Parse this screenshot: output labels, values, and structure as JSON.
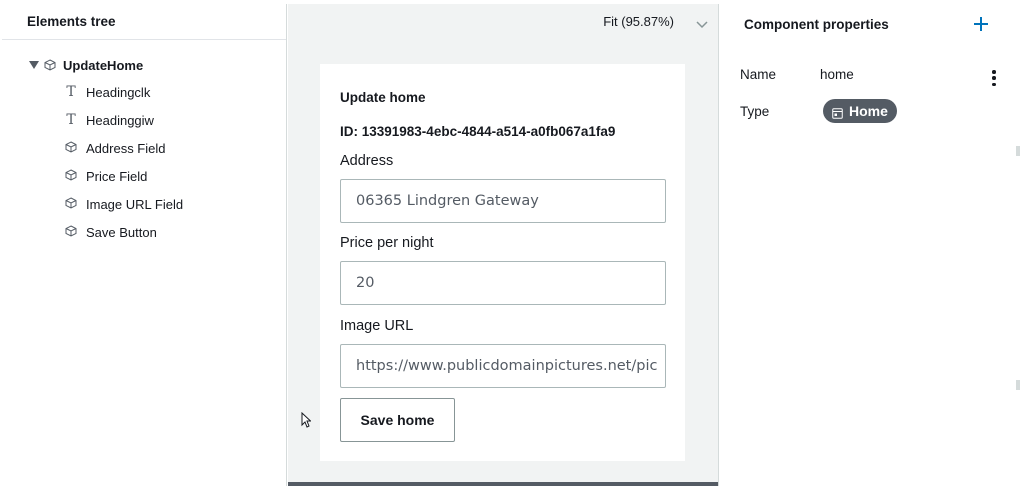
{
  "elements_tree": {
    "title": "Elements tree",
    "root": {
      "label": "UpdateHome",
      "icon": "cube-icon",
      "expanded": true
    },
    "children": [
      {
        "label": "Headingclk",
        "icon": "text-icon"
      },
      {
        "label": "Headinggiw",
        "icon": "text-icon"
      },
      {
        "label": "Address Field",
        "icon": "cube-icon"
      },
      {
        "label": "Price Field",
        "icon": "cube-icon"
      },
      {
        "label": "Image URL Field",
        "icon": "cube-icon"
      },
      {
        "label": "Save Button",
        "icon": "cube-icon"
      }
    ]
  },
  "canvas": {
    "zoom_label": "Fit (95.87%)",
    "form": {
      "title": "Update home",
      "id_text": "ID: 13391983-4ebc-4844-a514-a0fb067a1fa9",
      "address": {
        "label": "Address",
        "value": "06365 Lindgren Gateway"
      },
      "price": {
        "label": "Price per night",
        "value": "20"
      },
      "image_url": {
        "label": "Image URL",
        "value": "https://www.publicdomainpictures.net/pic"
      },
      "save_label": "Save home"
    }
  },
  "component_properties": {
    "title": "Component properties",
    "name_label": "Name",
    "name_value": "home",
    "type_label": "Type",
    "type_value": "Home",
    "accent_color": "#0073bb"
  }
}
